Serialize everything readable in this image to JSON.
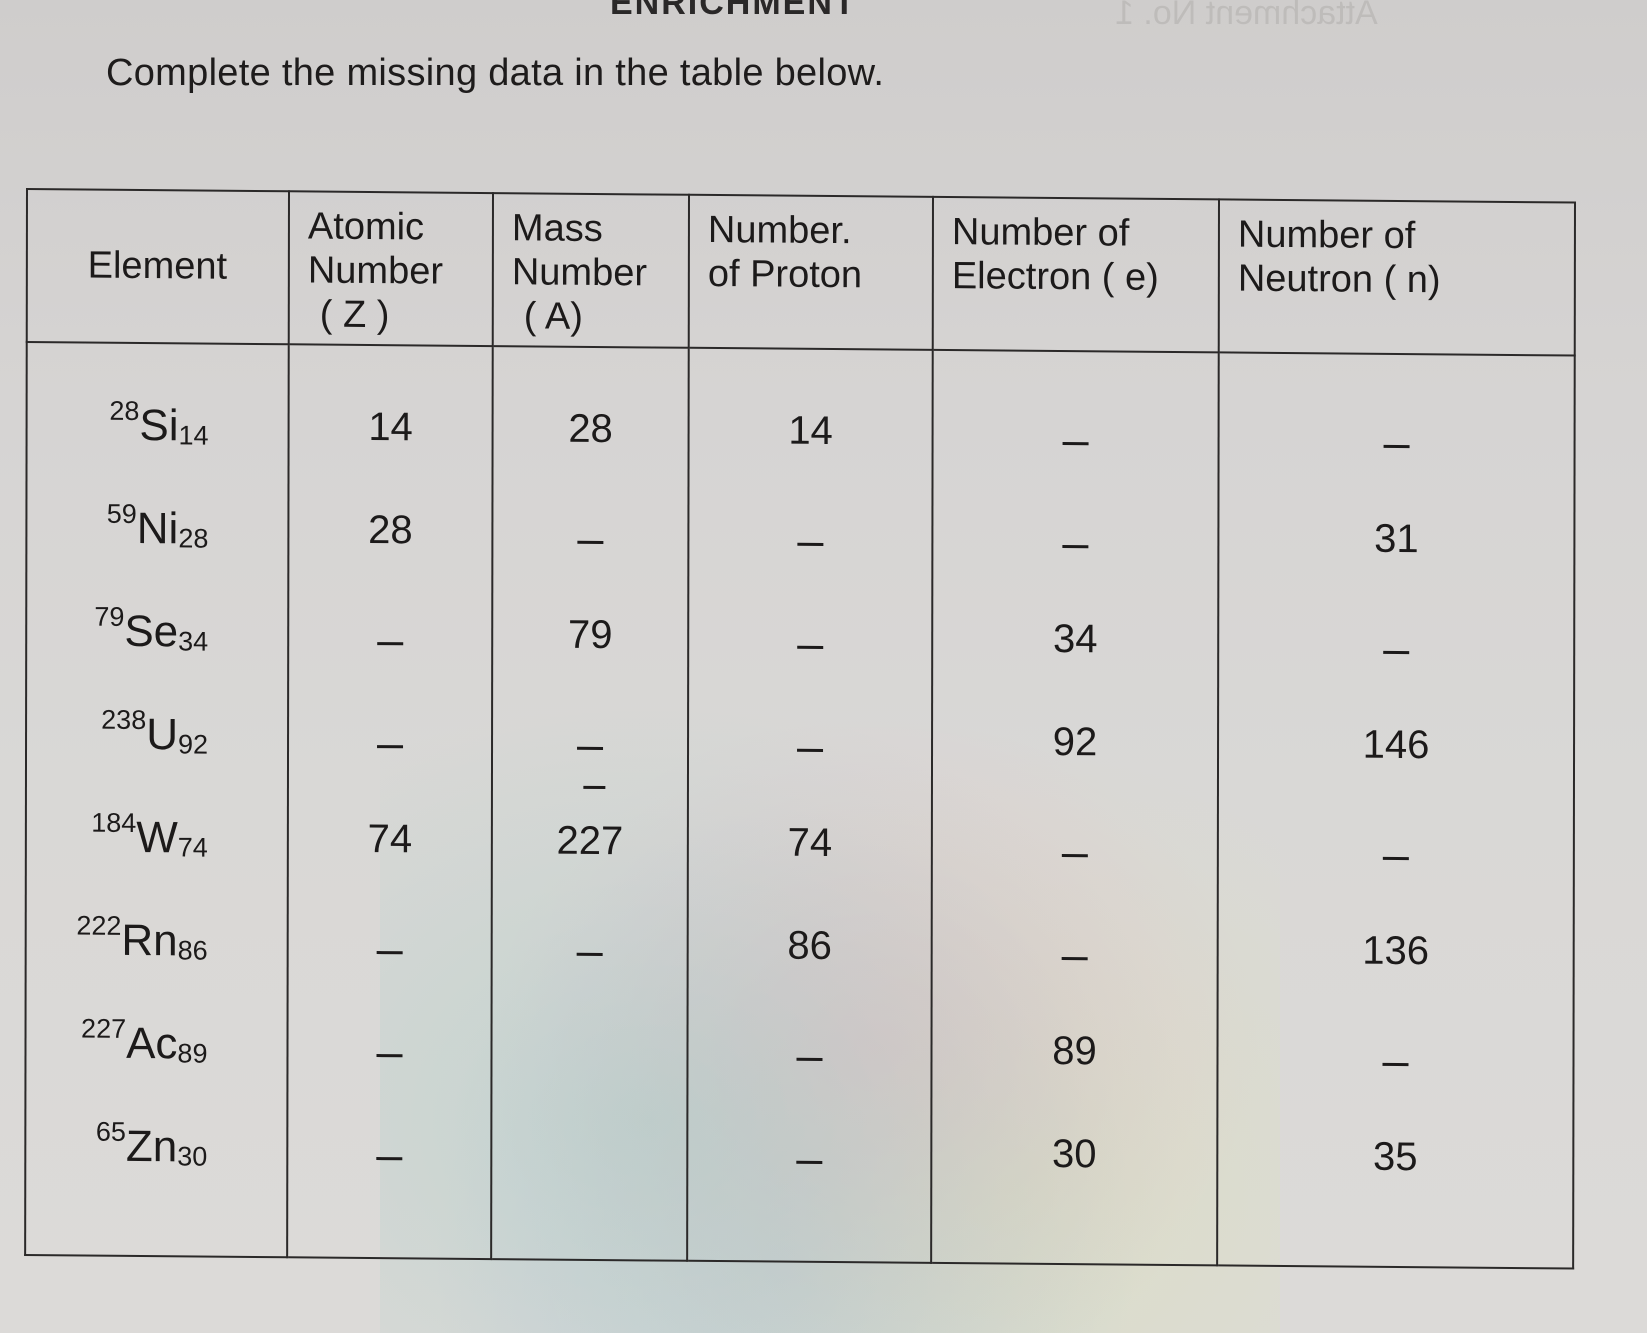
{
  "page": {
    "header_partial": "ENRICHMENT",
    "mirror_text": "Attachment No. 1",
    "instruction": "Complete the missing data in the table below."
  },
  "table": {
    "headers": {
      "element": "Element",
      "atomic_number": [
        "Atomic",
        "Number",
        "( Z )"
      ],
      "mass_number": [
        "Mass",
        "Number",
        "( A)"
      ],
      "protons": [
        "Number.",
        "of Proton"
      ],
      "electrons": [
        "Number of",
        "Electron ( e)"
      ],
      "neutrons": [
        "Number of",
        "Neutron ( n)"
      ]
    },
    "rows": [
      {
        "mass": "28",
        "symbol": "Si",
        "atomic": "14",
        "Z": "14",
        "A": "28",
        "p": "14",
        "e": "_",
        "n": "_"
      },
      {
        "mass": "59",
        "symbol": "Ni",
        "atomic": "28",
        "Z": "28",
        "A": "_",
        "p": "_",
        "e": "_",
        "n": "31"
      },
      {
        "mass": "79",
        "symbol": "Se",
        "atomic": "34",
        "Z": "_",
        "A": "79",
        "p": "_",
        "e": "34",
        "n": "_"
      },
      {
        "mass": "238",
        "symbol": "U",
        "atomic": "92",
        "Z": "_",
        "A": "_",
        "p": "_",
        "e": "92",
        "n": "146"
      },
      {
        "mass": "184",
        "symbol": "W",
        "atomic": "74",
        "Z": "74",
        "A": "227",
        "p": "74",
        "e": "_",
        "n": "_"
      },
      {
        "mass": "222",
        "symbol": "Rn",
        "atomic": "86",
        "Z": "_",
        "A": "_",
        "p": "86",
        "e": "_",
        "n": "136"
      },
      {
        "mass": "227",
        "symbol": "Ac",
        "atomic": "89",
        "Z": "_",
        "A": "",
        "p": "_",
        "e": "89",
        "n": "_"
      },
      {
        "mass": "65",
        "symbol": "Zn",
        "atomic": "30",
        "Z": "_",
        "A": "",
        "p": "_",
        "e": "30",
        "n": "35"
      }
    ]
  }
}
